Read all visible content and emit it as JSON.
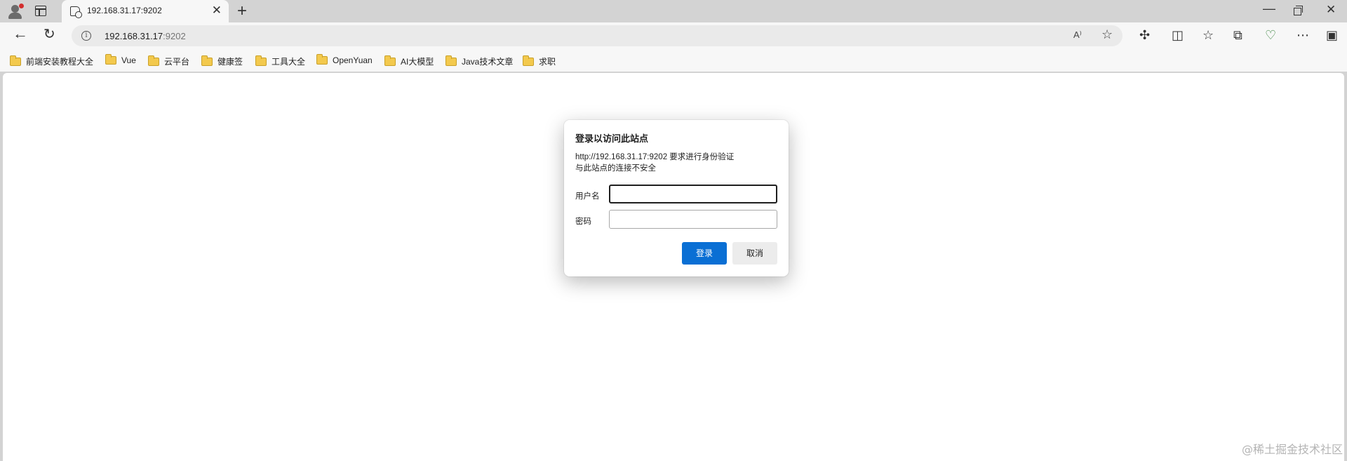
{
  "tabs": [
    {
      "title": "192.168.31.17:9202"
    }
  ],
  "address_bar": {
    "host": "192.168.31.17",
    "port": ":9202",
    "read_aloud": "A⁾",
    "favorite": "☆"
  },
  "bookmarks": [
    {
      "label": "前端安装教程大全"
    },
    {
      "label": "Vue"
    },
    {
      "label": "云平台"
    },
    {
      "label": "健康签"
    },
    {
      "label": "工具大全"
    },
    {
      "label": "OpenYuan"
    },
    {
      "label": "AI大模型"
    },
    {
      "label": "Java技术文章"
    },
    {
      "label": "求职"
    }
  ],
  "auth_dialog": {
    "title": "登录以访问此站点",
    "message_line1": "http://192.168.31.17:9202 要求进行身份验证",
    "message_line2": "与此站点的连接不安全",
    "username_label": "用户名",
    "username_value": "",
    "password_label": "密码",
    "password_value": "",
    "login_button": "登录",
    "cancel_button": "取消"
  },
  "watermark": "@稀土掘金技术社区",
  "icons": {
    "back": "back-arrow-icon",
    "refresh": "refresh-icon",
    "info": "info-icon",
    "extensions": "extensions-icon",
    "split": "split-screen-icon",
    "favorites": "favorites-icon",
    "collections": "collections-icon",
    "performance": "performance-icon",
    "more": "more-icon",
    "sidebar": "sidebar-icon"
  },
  "colors": {
    "accent": "#0a6fd4",
    "folder": "#f3c94d"
  }
}
